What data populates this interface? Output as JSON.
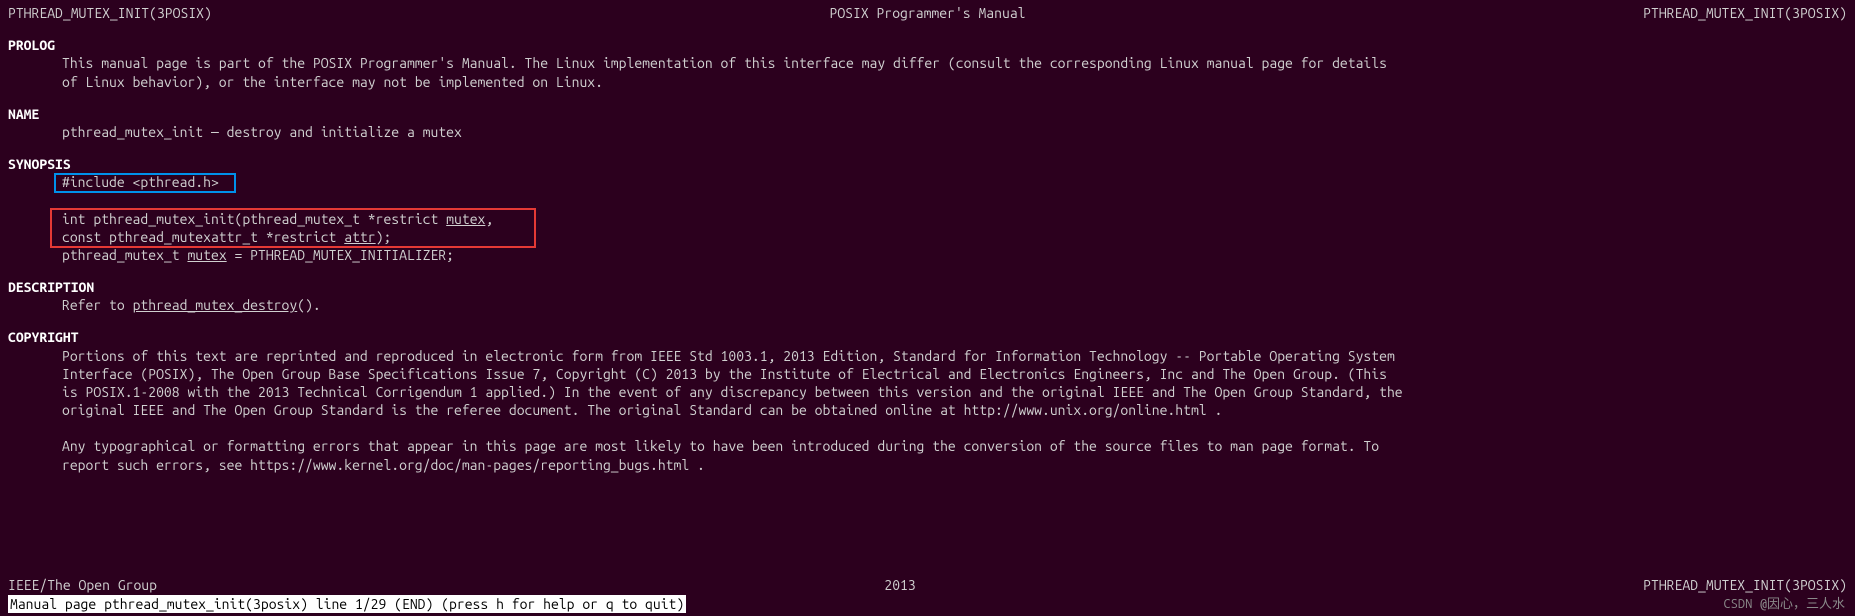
{
  "header": {
    "left": "PTHREAD_MUTEX_INIT(3POSIX)",
    "center": "POSIX Programmer's Manual",
    "right": "PTHREAD_MUTEX_INIT(3POSIX)"
  },
  "sections": {
    "prolog": {
      "heading": "PROLOG",
      "text1": "This  manual page is part of the POSIX Programmer's Manual.  The Linux implementation of this interface may differ (consult the corresponding Linux manual page for details",
      "text2": "of Linux behavior), or the interface may not be implemented on Linux."
    },
    "name": {
      "heading": "NAME",
      "text": "pthread_mutex_init — destroy and initialize a mutex"
    },
    "synopsis": {
      "heading": "SYNOPSIS",
      "include": "#include <pthread.h>",
      "func_line1_pre": "int pthread_mutex_init(pthread_mutex_t *restrict ",
      "func_line1_arg": "mutex",
      "func_line1_post": ",",
      "func_line2_pre": "    const pthread_mutexattr_t *restrict ",
      "func_line2_arg": "attr",
      "func_line2_post": ");",
      "initializer_pre": "pthread_mutex_t ",
      "initializer_arg": "mutex",
      "initializer_post": " = PTHREAD_MUTEX_INITIALIZER;"
    },
    "description": {
      "heading": "DESCRIPTION",
      "text_pre": "Refer to ",
      "link": "pthread_mutex_destroy",
      "text_post": "()."
    },
    "copyright": {
      "heading": "COPYRIGHT",
      "p1_l1": "Portions of this text are reprinted and reproduced in electronic form from IEEE Std 1003.1, 2013 Edition, Standard for Information Technology -- Portable Operating  System",
      "p1_l2": "Interface  (POSIX), The Open Group Base Specifications Issue 7, Copyright (C) 2013 by the Institute of Electrical and Electronics Engineers, Inc and The Open Group.  (This",
      "p1_l3": "is POSIX.1-2008 with the 2013 Technical Corrigendum 1 applied.) In the event of any discrepancy between this version and the original IEEE and The Open Group Standard, the",
      "p1_l4": "original IEEE and The Open Group Standard is the referee document. The original Standard can be obtained online at http://www.unix.org/online.html .",
      "p2_l1": "Any  typographical  or  formatting errors that appear in this page are most likely to have been introduced during the conversion of the source files to man page format. To",
      "p2_l2": "report such errors, see https://www.kernel.org/doc/man-pages/reporting_bugs.html ."
    }
  },
  "footer": {
    "left": "IEEE/The Open Group",
    "center": "2013",
    "right": "PTHREAD_MUTEX_INIT(3POSIX)"
  },
  "status_bar": " Manual page pthread_mutex_init(3posix) line 1/29 (END) (press h for help or q to quit)",
  "watermark": "CSDN @因心，三人水"
}
